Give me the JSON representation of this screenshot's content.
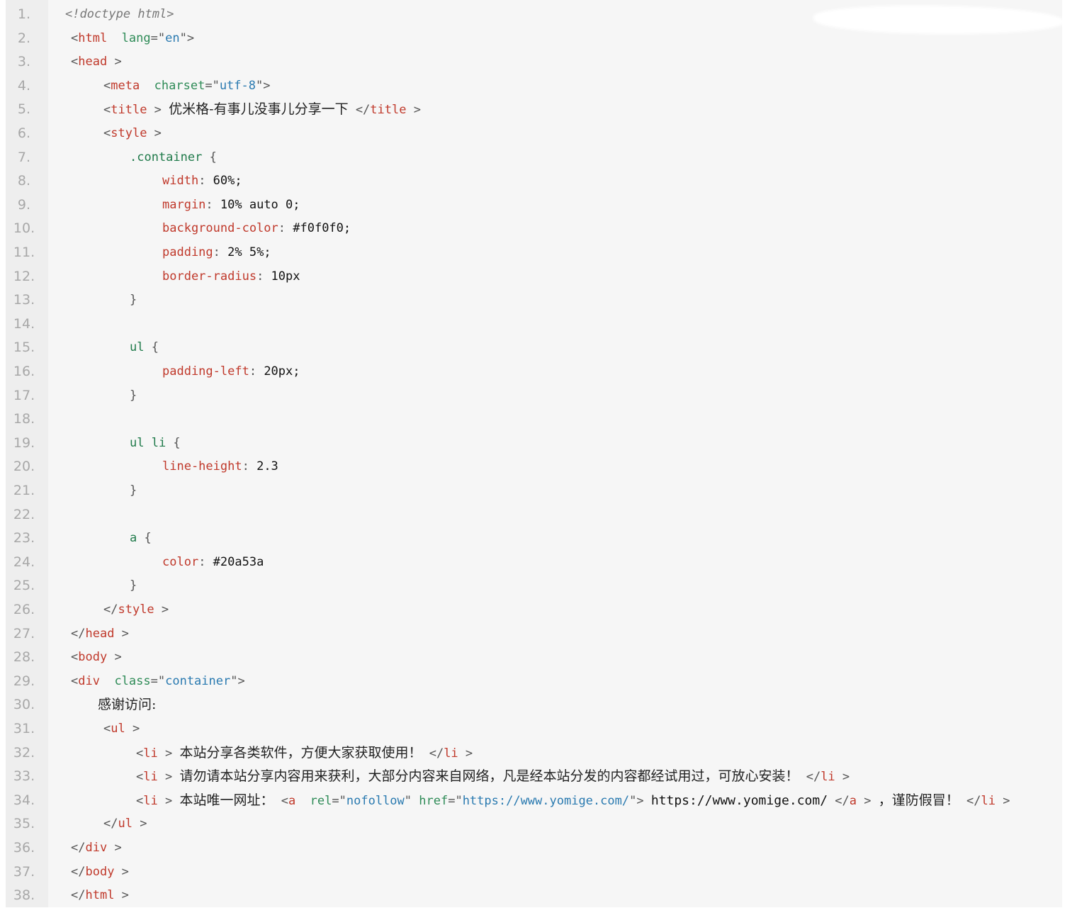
{
  "lines": [
    {
      "n": "1.",
      "indent": 92,
      "tokens": [
        {
          "t": "<!doctype html>",
          "c": "doc"
        }
      ]
    },
    {
      "n": "2.",
      "indent": 100,
      "tokens": [
        {
          "t": "<",
          "c": "punc"
        },
        {
          "t": "html",
          "c": "tag"
        },
        {
          "t": "  lang",
          "c": "attr"
        },
        {
          "t": "=\"",
          "c": "punc"
        },
        {
          "t": "en",
          "c": "str"
        },
        {
          "t": "\">",
          "c": "punc"
        }
      ]
    },
    {
      "n": "3.",
      "indent": 100,
      "tokens": [
        {
          "t": "<",
          "c": "punc"
        },
        {
          "t": "head",
          "c": "tag"
        },
        {
          "t": " >",
          "c": "punc"
        }
      ]
    },
    {
      "n": "4.",
      "indent": 146,
      "tokens": [
        {
          "t": "<",
          "c": "punc"
        },
        {
          "t": "meta",
          "c": "tag"
        },
        {
          "t": "  charset",
          "c": "attr"
        },
        {
          "t": "=\"",
          "c": "punc"
        },
        {
          "t": "utf-8",
          "c": "str"
        },
        {
          "t": "\">",
          "c": "punc"
        }
      ]
    },
    {
      "n": "5.",
      "indent": 146,
      "tokens": [
        {
          "t": "<",
          "c": "punc"
        },
        {
          "t": "title",
          "c": "tag"
        },
        {
          "t": " > ",
          "c": "punc"
        },
        {
          "t": "优米格-有事儿没事儿分享一下",
          "c": "text"
        },
        {
          "t": " </",
          "c": "punc"
        },
        {
          "t": "title",
          "c": "tag"
        },
        {
          "t": " >",
          "c": "punc"
        }
      ]
    },
    {
      "n": "6.",
      "indent": 146,
      "tokens": [
        {
          "t": "<",
          "c": "punc"
        },
        {
          "t": "style",
          "c": "tag"
        },
        {
          "t": " >",
          "c": "punc"
        }
      ]
    },
    {
      "n": "7.",
      "indent": 183,
      "tokens": [
        {
          "t": ".container",
          "c": "sel"
        },
        {
          "t": " {",
          "c": "punc"
        }
      ]
    },
    {
      "n": "8.",
      "indent": 229,
      "tokens": [
        {
          "t": "width",
          "c": "prop"
        },
        {
          "t": ": ",
          "c": "punc"
        },
        {
          "t": "60%;",
          "c": "val"
        }
      ]
    },
    {
      "n": "9.",
      "indent": 229,
      "tokens": [
        {
          "t": "margin",
          "c": "prop"
        },
        {
          "t": ": ",
          "c": "punc"
        },
        {
          "t": "10% auto 0;",
          "c": "val"
        }
      ]
    },
    {
      "n": "10.",
      "indent": 229,
      "tokens": [
        {
          "t": "background-color",
          "c": "prop"
        },
        {
          "t": ": ",
          "c": "punc"
        },
        {
          "t": "#f0f0f0;",
          "c": "val"
        }
      ]
    },
    {
      "n": "11.",
      "indent": 229,
      "tokens": [
        {
          "t": "padding",
          "c": "prop"
        },
        {
          "t": ": ",
          "c": "punc"
        },
        {
          "t": "2% 5%;",
          "c": "val"
        }
      ]
    },
    {
      "n": "12.",
      "indent": 229,
      "tokens": [
        {
          "t": "border-radius",
          "c": "prop"
        },
        {
          "t": ": ",
          "c": "punc"
        },
        {
          "t": "10px",
          "c": "val"
        }
      ]
    },
    {
      "n": "13.",
      "indent": 183,
      "tokens": [
        {
          "t": "}",
          "c": "punc"
        }
      ]
    },
    {
      "n": "14.",
      "indent": 183,
      "tokens": []
    },
    {
      "n": "15.",
      "indent": 183,
      "tokens": [
        {
          "t": "ul",
          "c": "sel"
        },
        {
          "t": " {",
          "c": "punc"
        }
      ]
    },
    {
      "n": "16.",
      "indent": 229,
      "tokens": [
        {
          "t": "padding-left",
          "c": "prop"
        },
        {
          "t": ": ",
          "c": "punc"
        },
        {
          "t": "20px;",
          "c": "val"
        }
      ]
    },
    {
      "n": "17.",
      "indent": 183,
      "tokens": [
        {
          "t": "}",
          "c": "punc"
        }
      ]
    },
    {
      "n": "18.",
      "indent": 183,
      "tokens": []
    },
    {
      "n": "19.",
      "indent": 183,
      "tokens": [
        {
          "t": "ul li",
          "c": "sel"
        },
        {
          "t": " {",
          "c": "punc"
        }
      ]
    },
    {
      "n": "20.",
      "indent": 229,
      "tokens": [
        {
          "t": "line-height",
          "c": "prop"
        },
        {
          "t": ": ",
          "c": "punc"
        },
        {
          "t": "2.3",
          "c": "val"
        }
      ]
    },
    {
      "n": "21.",
      "indent": 183,
      "tokens": [
        {
          "t": "}",
          "c": "punc"
        }
      ]
    },
    {
      "n": "22.",
      "indent": 183,
      "tokens": []
    },
    {
      "n": "23.",
      "indent": 183,
      "tokens": [
        {
          "t": "a",
          "c": "sel"
        },
        {
          "t": " {",
          "c": "punc"
        }
      ]
    },
    {
      "n": "24.",
      "indent": 229,
      "tokens": [
        {
          "t": "color",
          "c": "prop"
        },
        {
          "t": ": ",
          "c": "punc"
        },
        {
          "t": "#20a53a",
          "c": "val"
        }
      ]
    },
    {
      "n": "25.",
      "indent": 183,
      "tokens": [
        {
          "t": "}",
          "c": "punc"
        }
      ]
    },
    {
      "n": "26.",
      "indent": 146,
      "tokens": [
        {
          "t": "</",
          "c": "punc"
        },
        {
          "t": "style",
          "c": "tag"
        },
        {
          "t": " >",
          "c": "punc"
        }
      ]
    },
    {
      "n": "27.",
      "indent": 100,
      "tokens": [
        {
          "t": "</",
          "c": "punc"
        },
        {
          "t": "head",
          "c": "tag"
        },
        {
          "t": " >",
          "c": "punc"
        }
      ]
    },
    {
      "n": "28.",
      "indent": 100,
      "tokens": [
        {
          "t": "<",
          "c": "punc"
        },
        {
          "t": "body",
          "c": "tag"
        },
        {
          "t": " >",
          "c": "punc"
        }
      ]
    },
    {
      "n": "29.",
      "indent": 100,
      "tokens": [
        {
          "t": "<",
          "c": "punc"
        },
        {
          "t": "div",
          "c": "tag"
        },
        {
          "t": "  class",
          "c": "attr"
        },
        {
          "t": "=\"",
          "c": "punc"
        },
        {
          "t": "container",
          "c": "str"
        },
        {
          "t": "\">",
          "c": "punc"
        }
      ]
    },
    {
      "n": "30.",
      "indent": 138,
      "tokens": [
        {
          "t": "感谢访问:",
          "c": "text"
        }
      ]
    },
    {
      "n": "31.",
      "indent": 146,
      "tokens": [
        {
          "t": "<",
          "c": "punc"
        },
        {
          "t": "ul",
          "c": "tag"
        },
        {
          "t": " >",
          "c": "punc"
        }
      ]
    },
    {
      "n": "32.",
      "indent": 192,
      "tokens": [
        {
          "t": "<",
          "c": "punc"
        },
        {
          "t": "li",
          "c": "tag"
        },
        {
          "t": " > ",
          "c": "punc"
        },
        {
          "t": "本站分享各类软件，方便大家获取使用！",
          "c": "text"
        },
        {
          "t": " </",
          "c": "punc"
        },
        {
          "t": "li",
          "c": "tag"
        },
        {
          "t": " >",
          "c": "punc"
        }
      ]
    },
    {
      "n": "33.",
      "indent": 192,
      "tokens": [
        {
          "t": "<",
          "c": "punc"
        },
        {
          "t": "li",
          "c": "tag"
        },
        {
          "t": " > ",
          "c": "punc"
        },
        {
          "t": "请勿请本站分享内容用来获利，大部分内容来自网络，凡是经本站分发的内容都经试用过，可放心安装！",
          "c": "text"
        },
        {
          "t": " </",
          "c": "punc"
        },
        {
          "t": "li",
          "c": "tag"
        },
        {
          "t": " >",
          "c": "punc"
        }
      ]
    },
    {
      "n": "34.",
      "indent": 192,
      "tokens": [
        {
          "t": "<",
          "c": "punc"
        },
        {
          "t": "li",
          "c": "tag"
        },
        {
          "t": " > ",
          "c": "punc"
        },
        {
          "t": "本站唯一网址：",
          "c": "text"
        },
        {
          "t": " <",
          "c": "punc"
        },
        {
          "t": "a",
          "c": "tag"
        },
        {
          "t": "  rel",
          "c": "attr"
        },
        {
          "t": "=\"",
          "c": "punc"
        },
        {
          "t": "nofollow",
          "c": "str"
        },
        {
          "t": "\" ",
          "c": "punc"
        },
        {
          "t": "href",
          "c": "attr"
        },
        {
          "t": "=\"",
          "c": "punc"
        },
        {
          "t": "https://www.yomige.com/",
          "c": "str"
        },
        {
          "t": "\"> ",
          "c": "punc"
        },
        {
          "t": "https://www.yomige.com/",
          "c": "url"
        },
        {
          "t": " </",
          "c": "punc"
        },
        {
          "t": "a",
          "c": "tag"
        },
        {
          "t": " > ",
          "c": "punc"
        },
        {
          "t": "，谨防假冒！",
          "c": "text"
        },
        {
          "t": " </",
          "c": "punc"
        },
        {
          "t": "li",
          "c": "tag"
        },
        {
          "t": " >",
          "c": "punc"
        }
      ]
    },
    {
      "n": "35.",
      "indent": 146,
      "tokens": [
        {
          "t": "</",
          "c": "punc"
        },
        {
          "t": "ul",
          "c": "tag"
        },
        {
          "t": " >",
          "c": "punc"
        }
      ]
    },
    {
      "n": "36.",
      "indent": 100,
      "tokens": [
        {
          "t": "</",
          "c": "punc"
        },
        {
          "t": "div",
          "c": "tag"
        },
        {
          "t": " >",
          "c": "punc"
        }
      ]
    },
    {
      "n": "37.",
      "indent": 100,
      "tokens": [
        {
          "t": "</",
          "c": "punc"
        },
        {
          "t": "body",
          "c": "tag"
        },
        {
          "t": " >",
          "c": "punc"
        }
      ]
    },
    {
      "n": "38.",
      "indent": 100,
      "tokens": [
        {
          "t": "</",
          "c": "punc"
        },
        {
          "t": "html",
          "c": "tag"
        },
        {
          "t": " >",
          "c": "punc"
        }
      ]
    }
  ]
}
